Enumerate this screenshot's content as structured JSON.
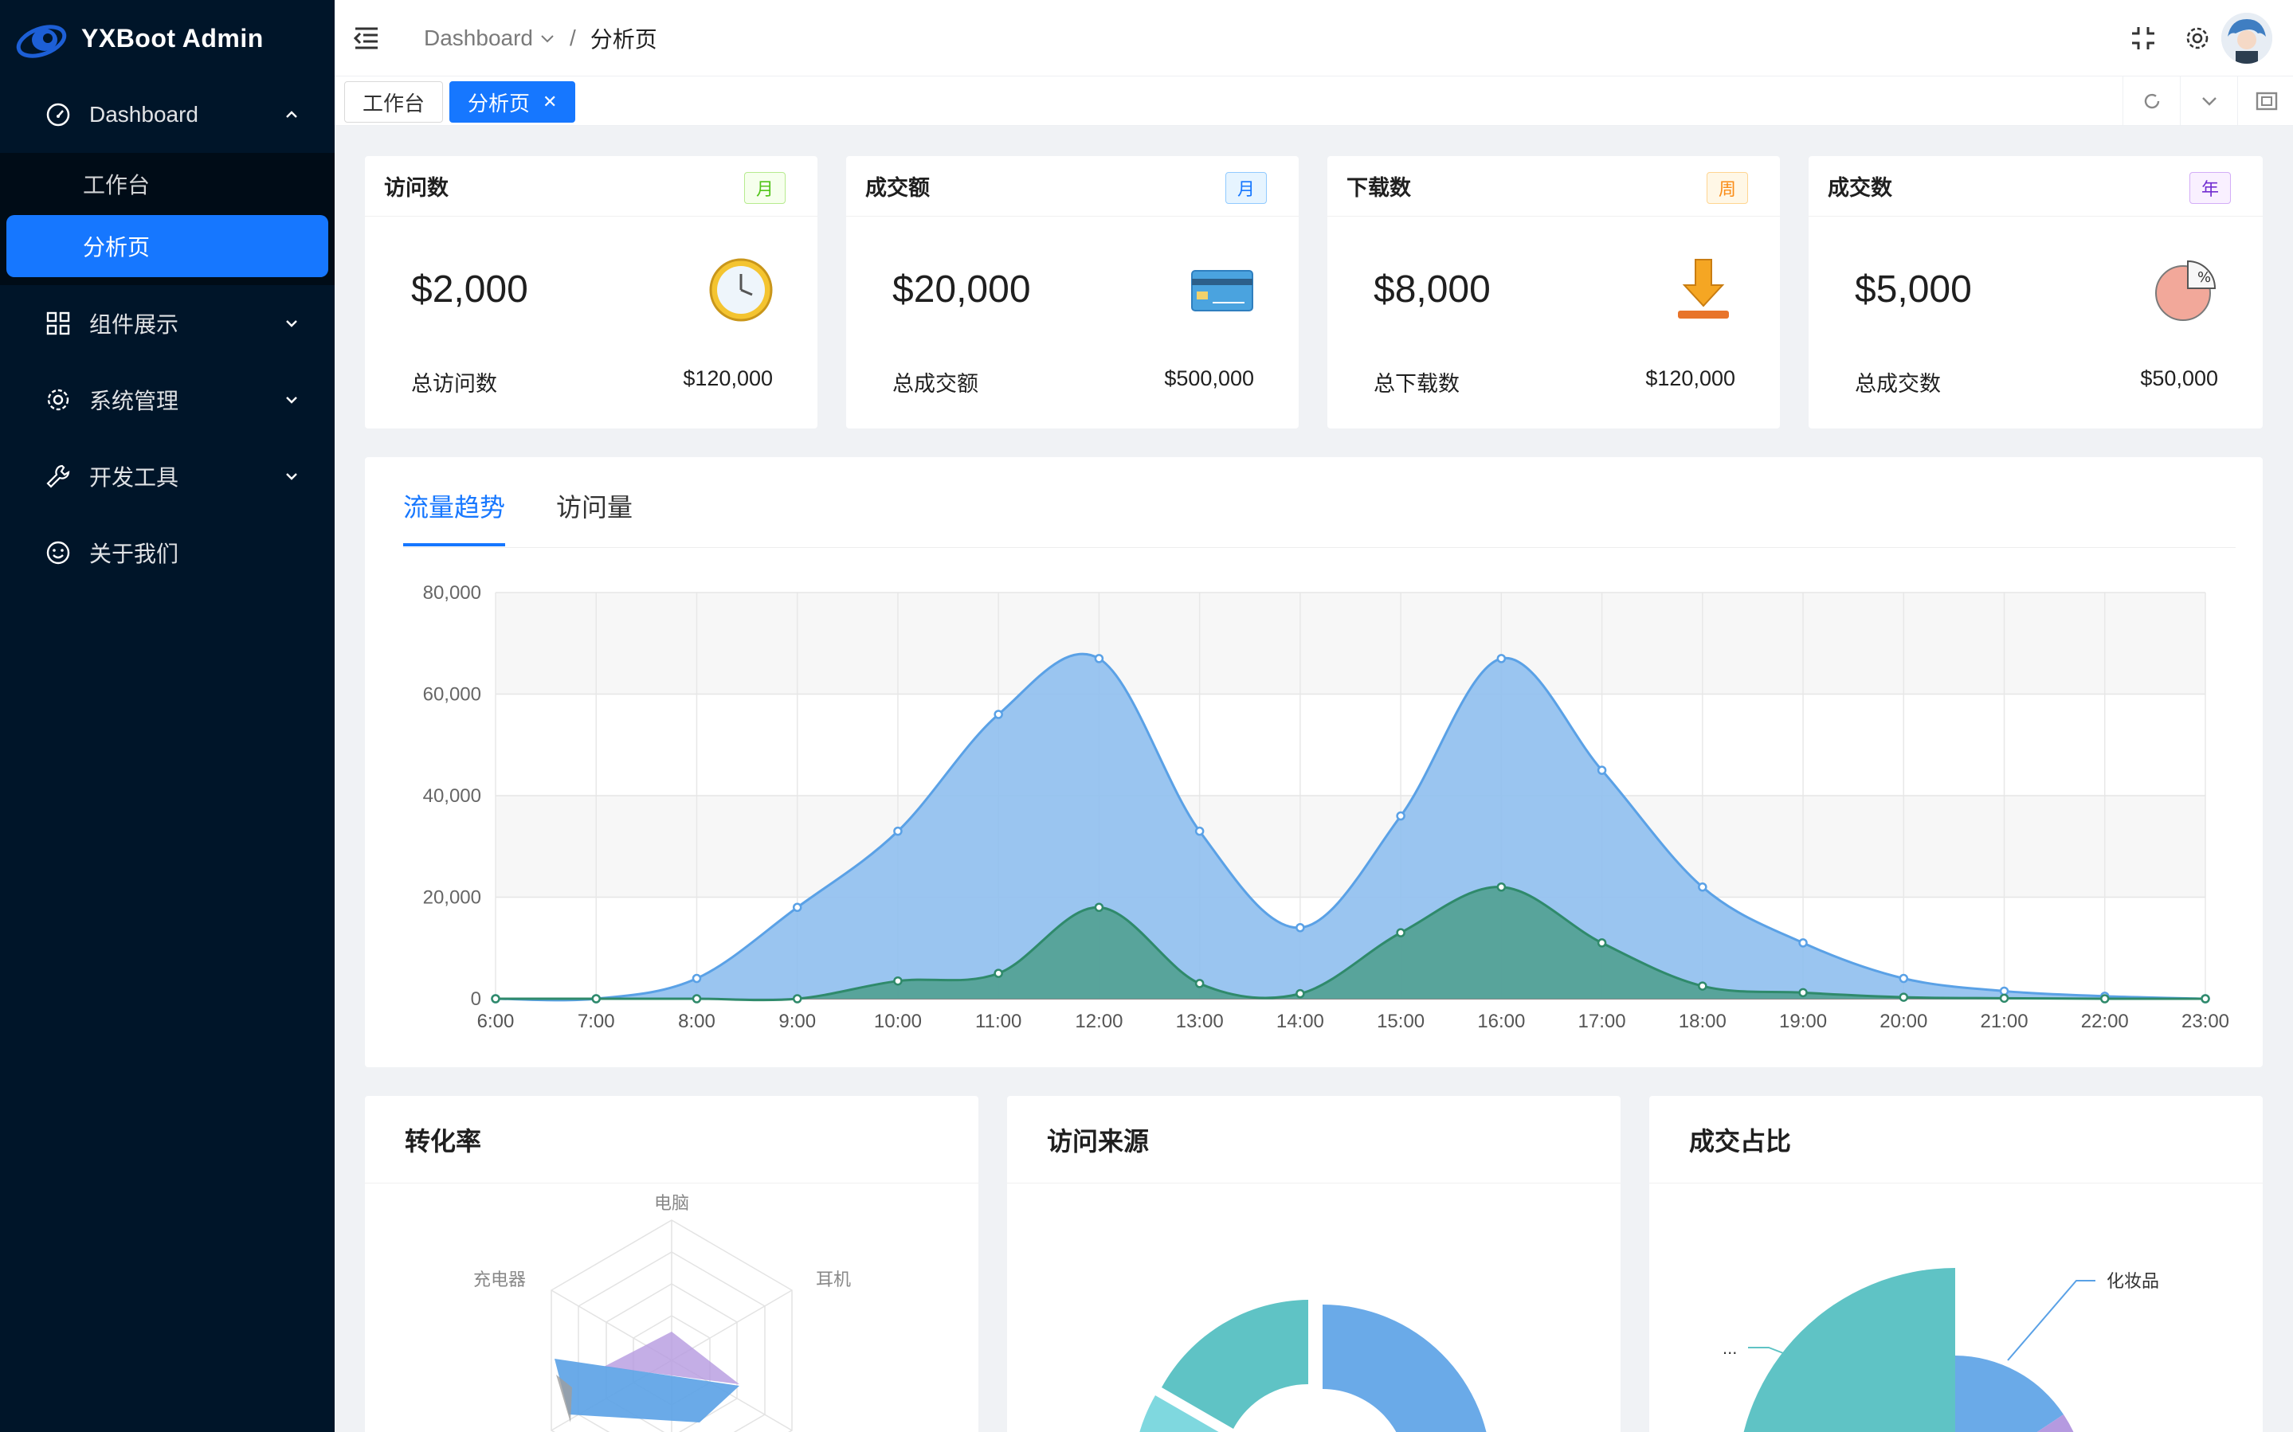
{
  "app": {
    "title": "YXBoot Admin"
  },
  "sidebar": {
    "items": [
      {
        "label": "Dashboard",
        "icon": "dashboard-icon",
        "expanded": true,
        "children": [
          {
            "label": "工作台"
          },
          {
            "label": "分析页",
            "active": true
          }
        ]
      },
      {
        "label": "组件展示",
        "icon": "appstore-icon"
      },
      {
        "label": "系统管理",
        "icon": "setting-icon"
      },
      {
        "label": "开发工具",
        "icon": "tool-icon"
      },
      {
        "label": "关于我们",
        "icon": "smile-icon"
      }
    ]
  },
  "header": {
    "breadcrumb": [
      "Dashboard",
      "分析页"
    ],
    "icons": [
      "fullscreen-icon",
      "setting-icon",
      "avatar"
    ]
  },
  "tabs": [
    {
      "label": "工作台",
      "active": false
    },
    {
      "label": "分析页",
      "active": true
    }
  ],
  "stats": [
    {
      "title": "访问数",
      "tag": "月",
      "tag_color": "#52c41a",
      "value": "$2,000",
      "foot_label": "总访问数",
      "foot_value": "$120,000",
      "icon": "clock-icon"
    },
    {
      "title": "成交额",
      "tag": "月",
      "tag_color": "#1677ff",
      "value": "$20,000",
      "foot_label": "总成交额",
      "foot_value": "$500,000",
      "icon": "credit-card-icon"
    },
    {
      "title": "下载数",
      "tag": "周",
      "tag_color": "#fa8c16",
      "value": "$8,000",
      "foot_label": "总下载数",
      "foot_value": "$120,000",
      "icon": "download-icon"
    },
    {
      "title": "成交数",
      "tag": "年",
      "tag_color": "#722ed1",
      "value": "$5,000",
      "foot_label": "总成交数",
      "foot_value": "$50,000",
      "icon": "pie-percent-icon"
    }
  ],
  "chart_tabs": [
    "流量趋势",
    "访问量"
  ],
  "panels": {
    "conversion": "转化率",
    "source": "访问来源",
    "deal": "成交占比"
  },
  "radar_labels": [
    "电脑",
    "充电器",
    "耳机"
  ],
  "deal_labels": [
    "化妆品",
    "..."
  ],
  "colors": {
    "primary": "#1677ff",
    "sidebar": "#001529",
    "area1": "#5aa1e6",
    "area2": "#3a9a7b"
  },
  "chart_data": {
    "type": "area",
    "x": [
      "6:00",
      "7:00",
      "8:00",
      "9:00",
      "10:00",
      "11:00",
      "12:00",
      "13:00",
      "14:00",
      "15:00",
      "16:00",
      "17:00",
      "18:00",
      "19:00",
      "20:00",
      "21:00",
      "22:00",
      "23:00"
    ],
    "series": [
      {
        "values": [
          0,
          0,
          4000,
          18000,
          33000,
          56000,
          67000,
          33000,
          14000,
          36000,
          67000,
          45000,
          22000,
          11000,
          4000,
          1500,
          500,
          0
        ]
      },
      {
        "values": [
          0,
          0,
          0,
          0,
          3500,
          5000,
          18000,
          3000,
          1000,
          13000,
          22000,
          11000,
          2500,
          1200,
          300,
          100,
          0,
          0
        ]
      }
    ],
    "yticks": [
      "0",
      "20,000",
      "40,000",
      "60,000",
      "80,000"
    ],
    "ylim": [
      0,
      80000
    ],
    "grid": true
  }
}
